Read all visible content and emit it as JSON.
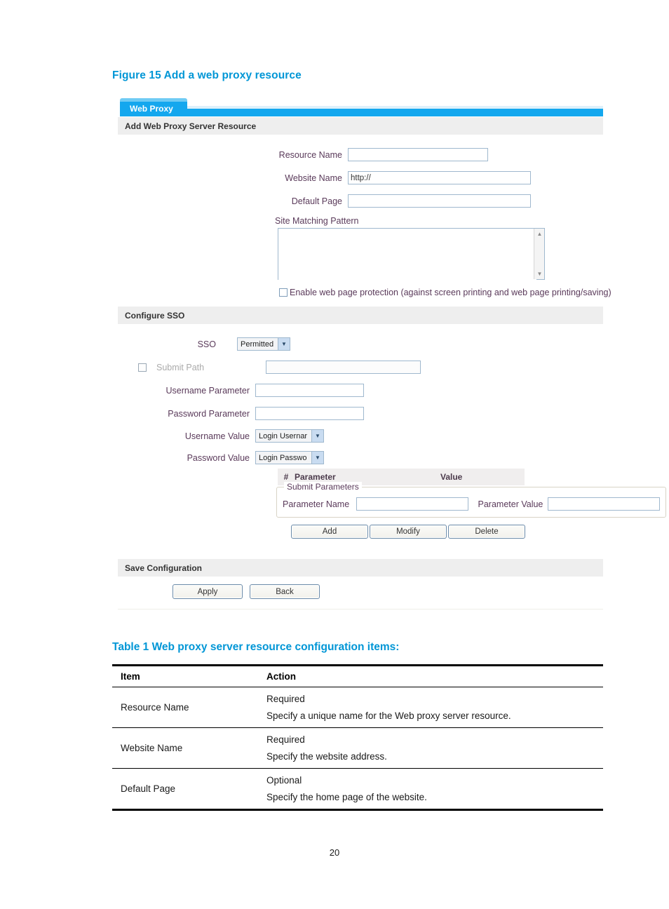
{
  "figure": {
    "caption": "Figure 15 Add a web proxy resource",
    "tab_label": "Web Proxy",
    "sections": {
      "resource_header": "Add Web Proxy Server Resource",
      "sso_header": "Configure SSO",
      "save_header": "Save Configuration"
    },
    "resource_form": {
      "resource_name_label": "Resource Name",
      "resource_name_value": "",
      "website_name_label": "Website Name",
      "website_name_value": "http://",
      "default_page_label": "Default Page",
      "default_page_value": "",
      "site_matching_label": "Site Matching Pattern",
      "site_matching_value": "",
      "protection_checkbox_label": "Enable web page protection (against screen printing and web page printing/saving)"
    },
    "sso_form": {
      "sso_label": "SSO",
      "sso_value": "Permitted",
      "sso_options": [
        "Permitted"
      ],
      "submit_path_label": "Submit Path",
      "submit_path_value": "",
      "username_parameter_label": "Username Parameter",
      "username_parameter_value": "",
      "password_parameter_label": "Password Parameter",
      "password_parameter_value": "",
      "username_value_label": "Username Value",
      "username_value_selected": "Login Usernar",
      "password_value_label": "Password Value",
      "password_value_selected": "Login Passwo",
      "param_table": {
        "col_hash": "#",
        "col_parameter": "Parameter",
        "col_value": "Value",
        "rows": []
      },
      "submit_parameters": {
        "legend": "Submit Parameters",
        "parameter_name_label": "Parameter Name",
        "parameter_name_value": "",
        "parameter_value_label": "Parameter Value",
        "parameter_value_value": ""
      },
      "buttons": {
        "add": "Add",
        "modify": "Modify",
        "delete": "Delete"
      }
    },
    "save_form": {
      "apply": "Apply",
      "back": "Back"
    },
    "colors": {
      "tab_blue": "#14a7ee",
      "tab_blue_light": "#6fcbf4",
      "section_grey": "#eeeeee",
      "label_purple": "#5a3a5a",
      "input_border": "#9fb8ce"
    }
  },
  "table": {
    "caption": "Table 1 Web proxy server resource configuration items:",
    "headers": [
      "Item",
      "Action"
    ],
    "rows": [
      {
        "item": "Resource Name",
        "line1": "Required",
        "line2": "Specify a unique name for the Web proxy server resource."
      },
      {
        "item": "Website Name",
        "line1": "Required",
        "line2": "Specify the website address."
      },
      {
        "item": "Default Page",
        "line1": "Optional",
        "line2": "Specify the home page of the website."
      }
    ]
  },
  "page_number": "20",
  "icons": {
    "chevron_down": "▼",
    "scroll_up": "▲",
    "scroll_down": "▼"
  }
}
